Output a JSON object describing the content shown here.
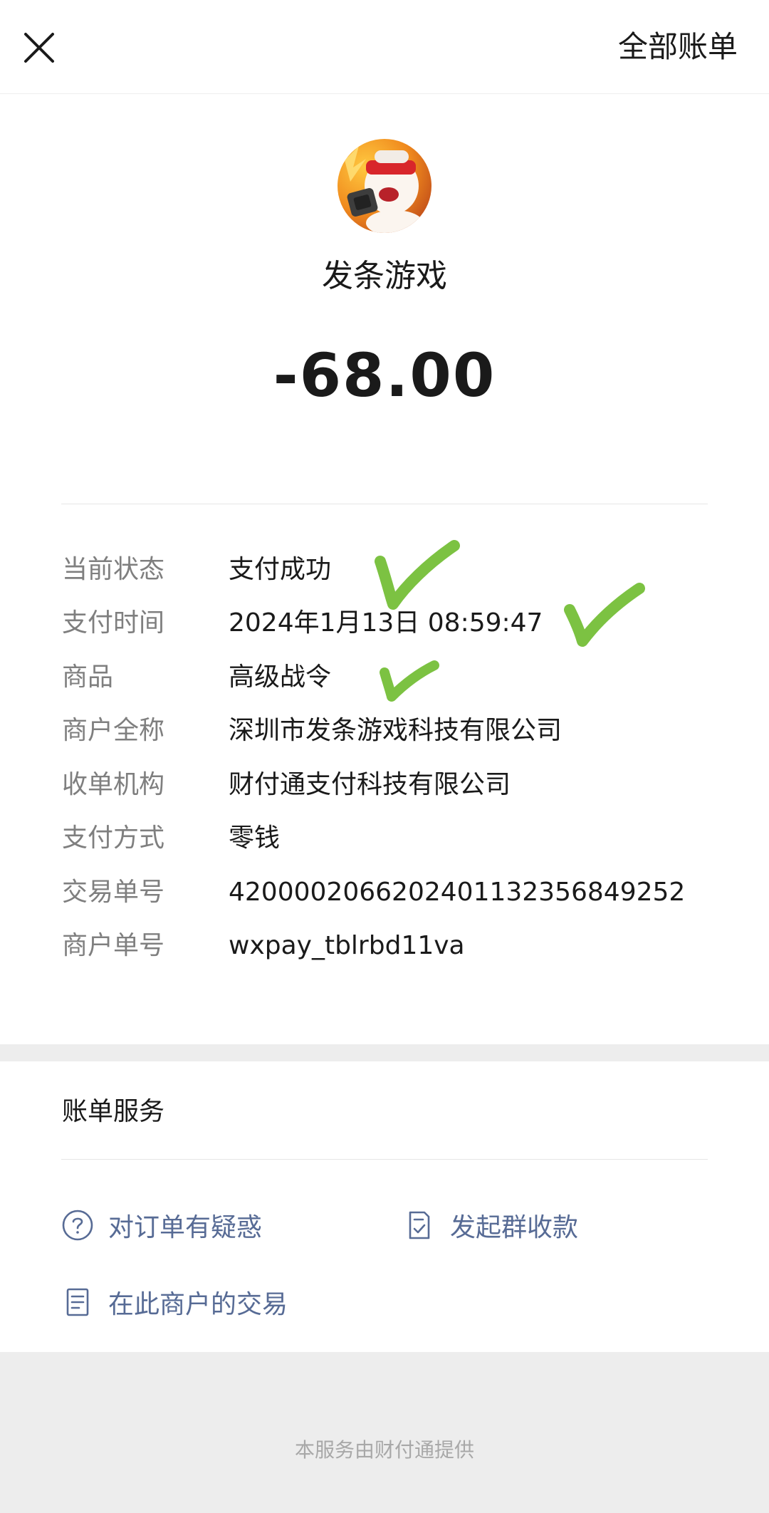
{
  "header": {
    "all_bills_label": "全部账单"
  },
  "transaction": {
    "merchant_name": "发条游戏",
    "amount": "-68.00"
  },
  "details": [
    {
      "label": "当前状态",
      "value": "支付成功"
    },
    {
      "label": "支付时间",
      "value": "2024年1月13日 08:59:47"
    },
    {
      "label": "商品",
      "value": "高级战令"
    },
    {
      "label": "商户全称",
      "value": "深圳市发条游戏科技有限公司"
    },
    {
      "label": "收单机构",
      "value": "财付通支付科技有限公司"
    },
    {
      "label": "支付方式",
      "value": "零钱"
    },
    {
      "label": "交易单号",
      "value": "4200002066202401132356849252"
    },
    {
      "label": "商户单号",
      "value": "wxpay_tblrbd11va"
    }
  ],
  "services": {
    "title": "账单服务",
    "links": [
      {
        "label": "对订单有疑惑",
        "icon": "question-circle-icon"
      },
      {
        "label": "发起群收款",
        "icon": "receipt-check-icon"
      },
      {
        "label": "在此商户的交易",
        "icon": "document-list-icon"
      }
    ]
  },
  "footer": {
    "text": "本服务由财付通提供"
  },
  "colors": {
    "link": "#576b95",
    "label_gray": "#7f7f7f",
    "checkmark_green": "#7cc242"
  }
}
